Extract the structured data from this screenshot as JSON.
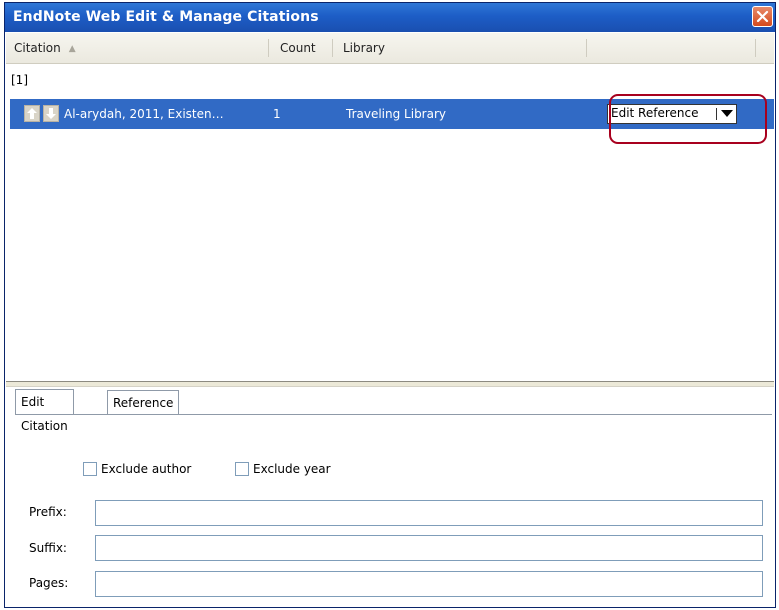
{
  "window": {
    "title": "EndNote Web Edit & Manage Citations"
  },
  "columns": {
    "citation": "Citation",
    "count": "Count",
    "library": "Library"
  },
  "citation_group": "[1]",
  "citation_row": {
    "citation": "Al-arydah, 2011, Existen…",
    "count": "1",
    "library": "Traveling Library",
    "action_label": "Edit Reference"
  },
  "tabs": [
    {
      "label": "Edit Citation",
      "active": true
    },
    {
      "label": "Reference",
      "active": false
    }
  ],
  "options": {
    "exclude_author": "Exclude author",
    "exclude_year": "Exclude year"
  },
  "fields": {
    "prefix": {
      "label": "Prefix:",
      "value": ""
    },
    "suffix": {
      "label": "Suffix:",
      "value": ""
    },
    "pages": {
      "label": "Pages:",
      "value": ""
    }
  },
  "colors": {
    "title_bar": "#1d5dc6",
    "selection": "#316ac5",
    "highlight_annotation": "#a8001e"
  }
}
